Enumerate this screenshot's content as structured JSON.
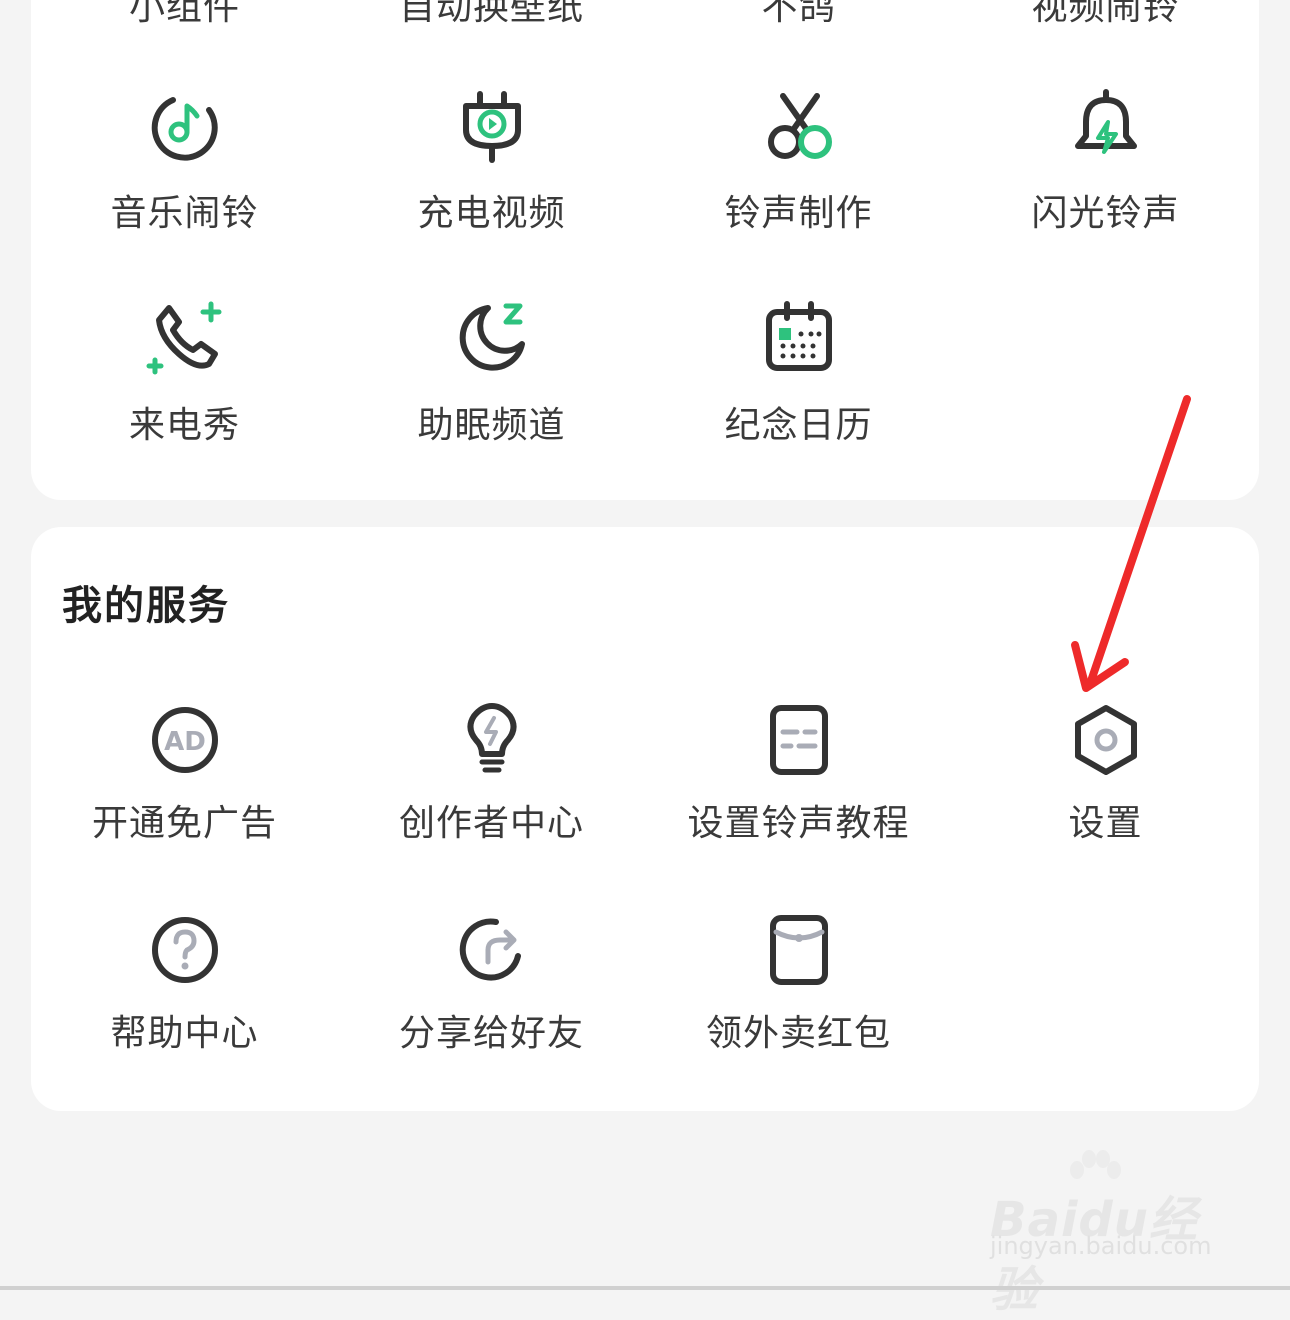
{
  "tools": {
    "row_top_labels": [
      "小组件",
      "自动换壁纸",
      "不鸽",
      "视频闹铃"
    ],
    "items": [
      {
        "label": "音乐闹铃",
        "icon": "music-alarm-icon"
      },
      {
        "label": "充电视频",
        "icon": "charging-video-icon"
      },
      {
        "label": "铃声制作",
        "icon": "scissors-icon"
      },
      {
        "label": "闪光铃声",
        "icon": "flash-bell-icon"
      },
      {
        "label": "来电秀",
        "icon": "phone-call-icon"
      },
      {
        "label": "助眠频道",
        "icon": "moon-sleep-icon"
      },
      {
        "label": "纪念日历",
        "icon": "calendar-icon"
      }
    ]
  },
  "services": {
    "title": "我的服务",
    "items": [
      {
        "label": "开通免广告",
        "icon": "ad-icon"
      },
      {
        "label": "创作者中心",
        "icon": "lightbulb-icon"
      },
      {
        "label": "设置铃声教程",
        "icon": "tutorial-icon"
      },
      {
        "label": "设置",
        "icon": "settings-hexagon-icon"
      },
      {
        "label": "帮助中心",
        "icon": "question-icon"
      },
      {
        "label": "分享给好友",
        "icon": "share-icon"
      },
      {
        "label": "领外卖红包",
        "icon": "red-packet-icon"
      }
    ]
  },
  "watermark": {
    "brand": "Baidu经验",
    "url": "jingyan.baidu.com"
  },
  "colors": {
    "accent": "#2ec27e",
    "icon_stroke": "#333333",
    "icon_gray": "#a9acb6",
    "annotation_arrow": "#ee2a2a"
  }
}
